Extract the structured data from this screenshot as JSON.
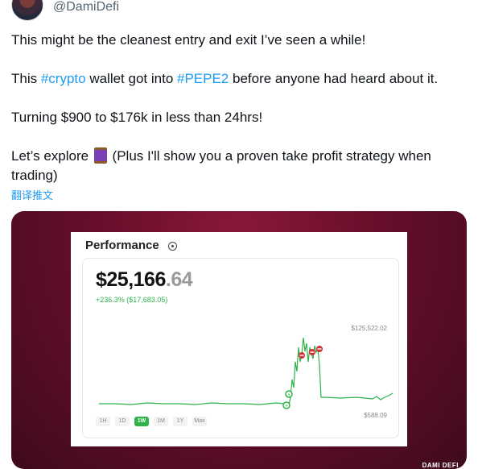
{
  "author": {
    "handle": "@DamiDefi"
  },
  "tweet": {
    "line1": "This might be the cleanest entry and exit I’ve seen a while!",
    "line2_pre": "This ",
    "line2_tag1": "#crypto",
    "line2_mid": " wallet got into ",
    "line2_tag2": "#PEPE2",
    "line2_post": " before anyone had heard about it.",
    "line3": "Turning $900 to $176k in less than 24hrs!",
    "line4_pre": "Let’s explore ",
    "line4_post": " (Plus I'll show you a proven take profit strategy when trading)",
    "emoji_icon": "thread-spool-icon"
  },
  "translate_label": "翻译推文",
  "media": {
    "title": "Performance",
    "balance_main": "$25,166",
    "balance_cents": ".64",
    "change": "+236.3% ($17,683.05)",
    "high_label": "$125,522.02",
    "low_label": "$588.09",
    "tabs": [
      "1H",
      "1D",
      "1W",
      "1M",
      "1Y",
      "Max"
    ],
    "active_tab": "1W",
    "watermark": "DAMI DEFI",
    "colors": {
      "line": "#2eb34a",
      "buy": "#2eb34a",
      "sell": "#d0323a",
      "background": "#6a0f2c"
    }
  }
}
